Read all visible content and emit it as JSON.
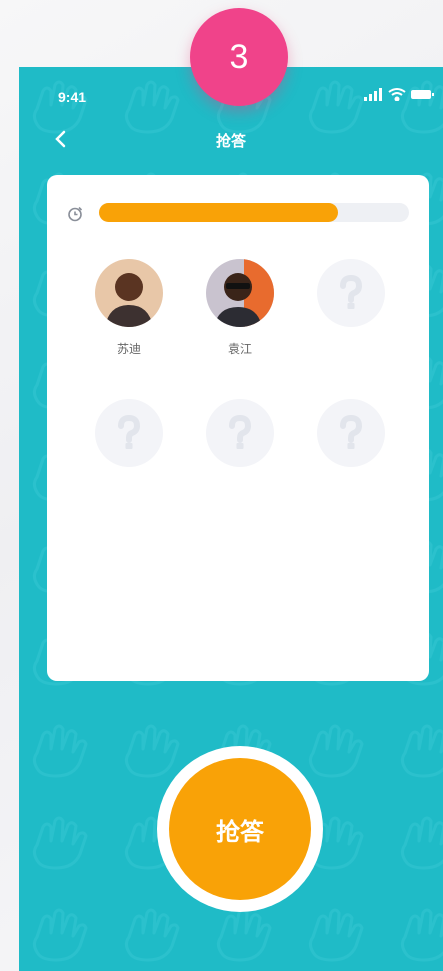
{
  "step_badge": "3",
  "status_bar": {
    "time": "9:41",
    "icons": [
      "signal-icon",
      "wifi-icon",
      "battery-icon"
    ]
  },
  "nav": {
    "back_icon": "chevron-left-icon",
    "title": "抢答"
  },
  "timer": {
    "icon": "timer-icon",
    "progress_fraction": 0.77
  },
  "participants": [
    {
      "name": "苏迪",
      "filled": true
    },
    {
      "name": "袁江",
      "filled": true
    },
    {
      "name": "",
      "filled": false
    },
    {
      "name": "",
      "filled": false
    },
    {
      "name": "",
      "filled": false
    },
    {
      "name": "",
      "filled": false
    }
  ],
  "placeholder_glyph": "?",
  "grab_button": {
    "label": "抢答"
  },
  "colors": {
    "background": "#1fbbc7",
    "accent": "#f9a207",
    "badge": "#f0438a",
    "card": "#ffffff"
  }
}
